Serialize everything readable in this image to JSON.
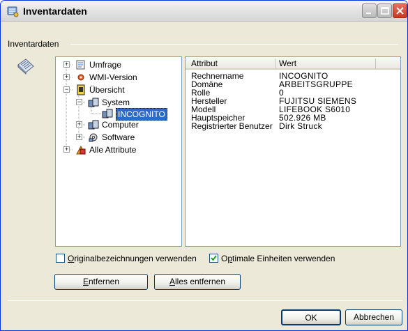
{
  "window": {
    "title": "Inventardaten",
    "icons": {
      "app": "inventory-app-icon",
      "minimize": "minimize-icon",
      "maximize": "maximize-icon",
      "close": "close-icon"
    }
  },
  "group": {
    "label": "Inventardaten",
    "icon": "inventory-notebook-icon"
  },
  "tree": {
    "items": [
      {
        "label": "Umfrage",
        "expander": "+",
        "icon": "survey-icon"
      },
      {
        "label": "WMI-Version",
        "expander": "+",
        "icon": "wmi-icon"
      },
      {
        "label": "Übersicht",
        "expander": "−",
        "icon": "overview-icon"
      },
      {
        "label": "System",
        "expander": "−",
        "icon": "system-icon"
      },
      {
        "label": "INCOGNITO",
        "expander": "",
        "icon": "computer-node-icon",
        "selected": true
      },
      {
        "label": "Computer",
        "expander": "+",
        "icon": "computer-icon"
      },
      {
        "label": "Software",
        "expander": "+",
        "icon": "software-icon"
      },
      {
        "label": "Alle Attribute",
        "expander": "+",
        "icon": "all-attributes-icon"
      }
    ]
  },
  "table": {
    "columns": [
      "Attribut",
      "Wert"
    ],
    "rows": [
      {
        "attribute": "Rechnername",
        "value": "INCOGNITO"
      },
      {
        "attribute": "Domäne",
        "value": "ARBEITSGRUPPE"
      },
      {
        "attribute": "Rolle",
        "value": "0"
      },
      {
        "attribute": "Hersteller",
        "value": "FUJITSU SIEMENS"
      },
      {
        "attribute": "Modell",
        "value": "LIFEBOOK S6010"
      },
      {
        "attribute": "Hauptspeicher",
        "value": "502.926 MB"
      },
      {
        "attribute": "Registrierter Benutzer",
        "value": "Dirk Struck"
      }
    ]
  },
  "options": {
    "original_names": {
      "mnemonic": "O",
      "rest": "riginalbezeichnungen verwenden",
      "checked": false
    },
    "optimal_units": {
      "before": "O",
      "mnemonic": "p",
      "rest": "timale Einheiten verwenden",
      "checked": true
    }
  },
  "buttons": {
    "remove": {
      "mnemonic": "E",
      "rest": "ntfernen"
    },
    "remove_all": {
      "mnemonic": "A",
      "rest": "lles entfernen"
    },
    "ok": {
      "label": "OK"
    },
    "cancel": {
      "label": "Abbrechen"
    }
  }
}
